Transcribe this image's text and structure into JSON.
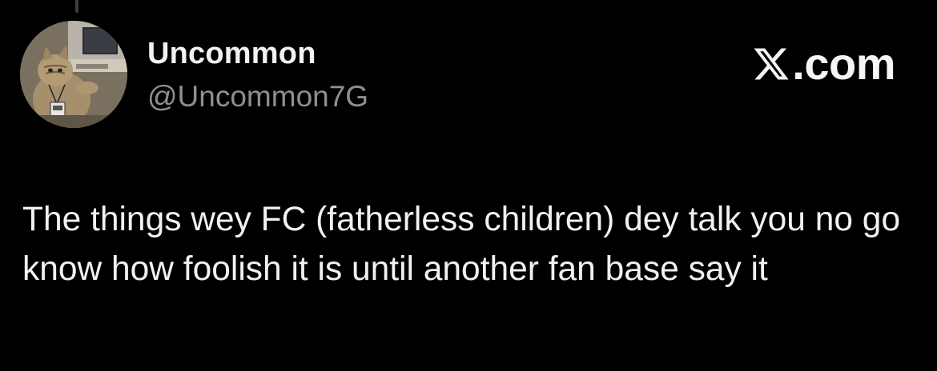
{
  "thread": {
    "connector": "thread-line"
  },
  "author": {
    "display_name": "Uncommon",
    "handle": "@Uncommon7G",
    "avatar": "cat-at-desk-avatar"
  },
  "brand": {
    "icon": "x-logo-icon",
    "text": ".com"
  },
  "tweet": {
    "text": "The things wey FC (fatherless children) dey talk you no go know how foolish it is until another fan base say it"
  },
  "colors": {
    "background": "#000000",
    "primary_text": "#e7e9ea",
    "secondary_text": "#8b9095"
  }
}
